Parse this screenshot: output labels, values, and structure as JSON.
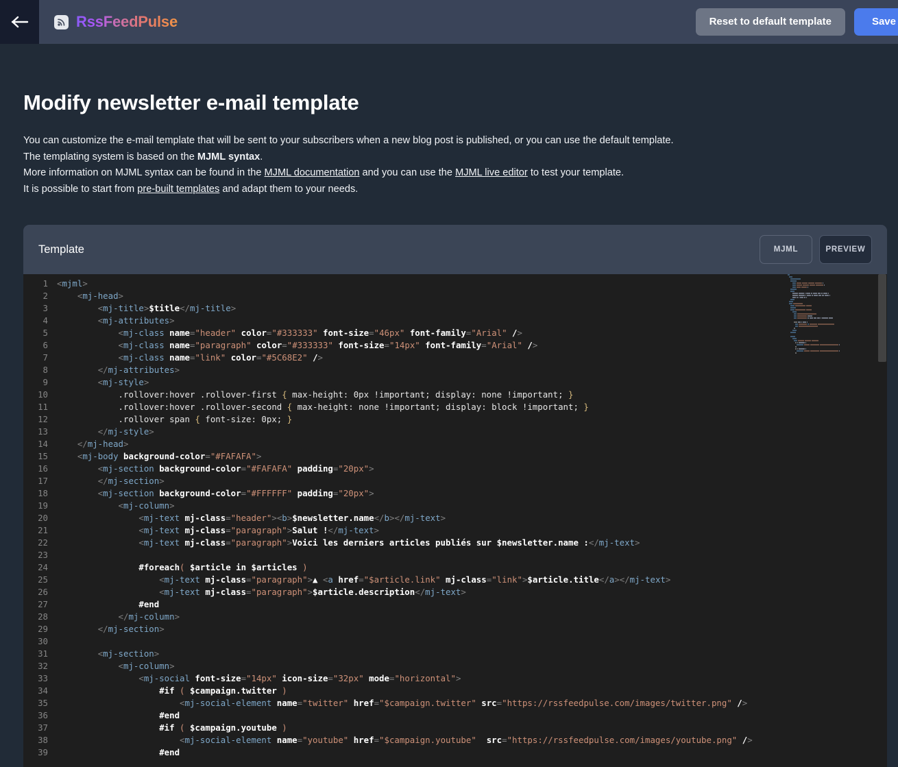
{
  "topbar": {
    "back_icon": "arrow-left-icon",
    "brand_icon": "rss-icon",
    "brand_name": "RssFeedPulse",
    "reset_label": "Reset to default template",
    "save_label": "Save",
    "accent_primary": "#4B7BEC",
    "accent_secondary": "#6D7585"
  },
  "page": {
    "title": "Modify newsletter e-mail template",
    "desc_line1_a": "You can customize the e-mail template that will be sent to your subscribers when a new blog post is published, or you can use the default template.",
    "desc_line2_a": "The templating system is based on the ",
    "desc_line2_b": "MJML syntax",
    "desc_line2_c": ".",
    "desc_line3_a": "More information on MJML syntax can be found in the ",
    "desc_line3_link1": "MJML documentation",
    "desc_line3_b": " and you can use the ",
    "desc_line3_link2": "MJML live editor",
    "desc_line3_c": " to test your template.",
    "desc_line4_a": "It is possible to start from ",
    "desc_line4_link": "pre-built templates",
    "desc_line4_b": " and adapt them to your needs."
  },
  "panel": {
    "title": "Template",
    "tab_mjml": "MJML",
    "tab_preview": "PREVIEW",
    "active_tab": "PREVIEW"
  },
  "editor": {
    "first_line": 1,
    "last_visible_line": 39,
    "language": "mjml",
    "lines": [
      "<mjml>",
      "    <mj-head>",
      "        <mj-title>$title</mj-title>",
      "        <mj-attributes>",
      "            <mj-class name=\"header\" color=\"#333333\" font-size=\"46px\" font-family=\"Arial\" />",
      "            <mj-class name=\"paragraph\" color=\"#333333\" font-size=\"14px\" font-family=\"Arial\" />",
      "            <mj-class name=\"link\" color=\"#5C68E2\" />",
      "        </mj-attributes>",
      "        <mj-style>",
      "            .rollover:hover .rollover-first { max-height: 0px !important; display: none !important; }",
      "            .rollover:hover .rollover-second { max-height: none !important; display: block !important; }",
      "            .rollover span { font-size: 0px; }",
      "        </mj-style>",
      "    </mj-head>",
      "    <mj-body background-color=\"#FAFAFA\">",
      "        <mj-section background-color=\"#FAFAFA\" padding=\"20px\">",
      "        </mj-section>",
      "        <mj-section background-color=\"#FFFFFF\" padding=\"20px\">",
      "            <mj-column>",
      "                <mj-text mj-class=\"header\"><b>$newsletter.name</b></mj-text>",
      "                <mj-text mj-class=\"paragraph\">Salut !</mj-text>",
      "                <mj-text mj-class=\"paragraph\">Voici les derniers articles publiés sur $newsletter.name :</mj-text>",
      "",
      "                #foreach( $article in $articles )",
      "                    <mj-text mj-class=\"paragraph\">▲ <a href=\"$article.link\" mj-class=\"link\">$article.title</a></mj-text>",
      "                    <mj-text mj-class=\"paragraph\">$article.description</mj-text>",
      "                #end",
      "            </mj-column>",
      "        </mj-section>",
      "",
      "        <mj-section>",
      "            <mj-column>",
      "                <mj-social font-size=\"14px\" icon-size=\"32px\" mode=\"horizontal\">",
      "                    #if ( $campaign.twitter )",
      "                        <mj-social-element name=\"twitter\" href=\"$campaign.twitter\" src=\"https://rssfeedpulse.com/images/twitter.png\" />",
      "                    #end",
      "                    #if ( $campaign.youtube )",
      "                        <mj-social-element name=\"youtube\" href=\"$campaign.youtube\"  src=\"https://rssfeedpulse.com/images/youtube.png\" />",
      "                    #end"
    ]
  },
  "colors": {
    "page_bg": "#212B37",
    "topbar_bg": "#3A4459",
    "back_bg": "#161C2D",
    "panel_bg": "#3B4556",
    "editor_bg": "#1E1E1E",
    "gutter_text": "#868686"
  }
}
